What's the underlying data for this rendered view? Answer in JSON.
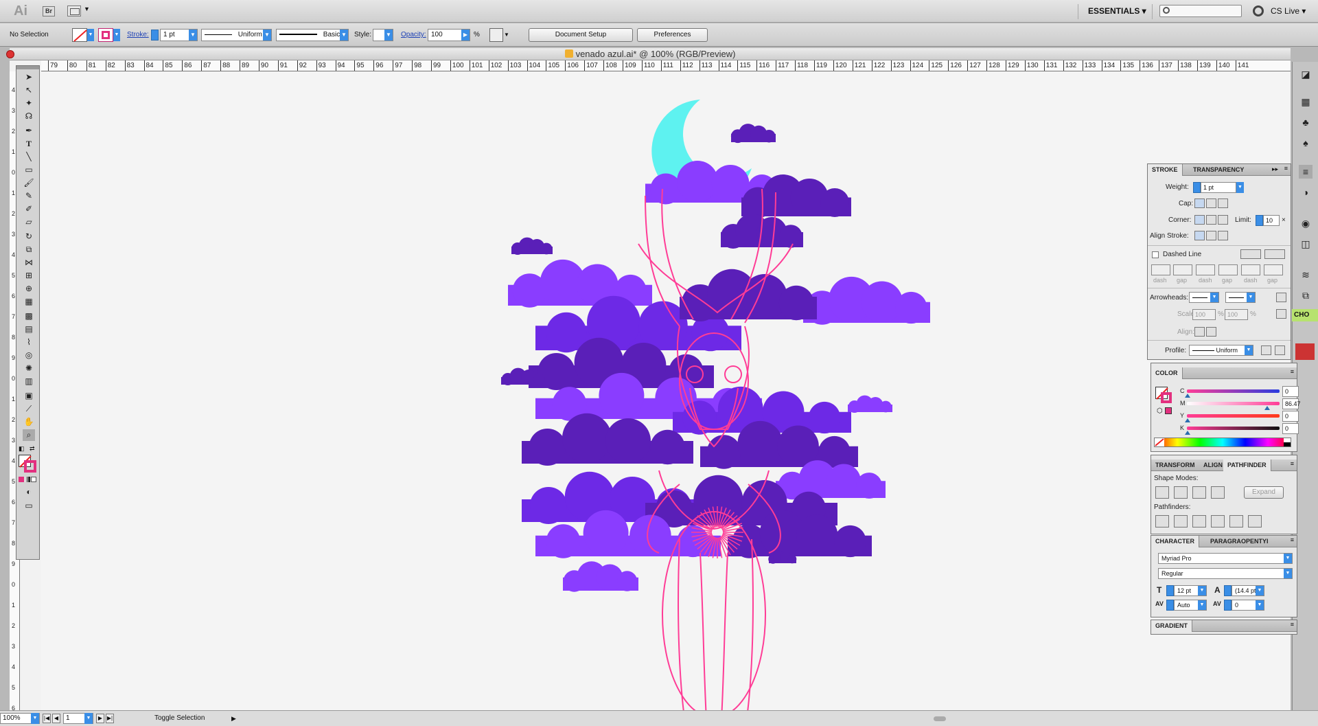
{
  "appbar": {
    "logo": "Ai",
    "bridge": "Br",
    "workspace": "ESSENTIALS ▾",
    "cslive": "CS Live ▾"
  },
  "control": {
    "selection": "No Selection",
    "stroke_label": "Stroke:",
    "stroke_value": "1 pt",
    "profile": "Uniform",
    "brush": "Basic",
    "style_label": "Style:",
    "opacity_label": "Opacity:",
    "opacity_value": "100",
    "percent": "%",
    "doc_setup": "Document Setup",
    "preferences": "Preferences"
  },
  "document": {
    "title": "venado azul.ai* @ 100% (RGB/Preview)",
    "ruler_ticks": [
      "79",
      "80",
      "81",
      "82",
      "83",
      "84",
      "85",
      "86",
      "87",
      "88",
      "89",
      "90",
      "91",
      "92",
      "93",
      "94",
      "95",
      "96",
      "97",
      "98",
      "99",
      "100",
      "101",
      "102",
      "103",
      "104",
      "105",
      "106",
      "107",
      "108",
      "109",
      "110",
      "111",
      "112",
      "113",
      "114",
      "115",
      "116",
      "117",
      "118",
      "119",
      "120",
      "121",
      "122",
      "123",
      "124",
      "125",
      "126",
      "127",
      "128",
      "129",
      "130",
      "131",
      "132",
      "133",
      "134",
      "135",
      "136",
      "137",
      "138",
      "139",
      "140",
      "141"
    ],
    "vruler_ticks": [
      "4",
      "3",
      "2",
      "1",
      "0",
      "1",
      "2",
      "3",
      "4",
      "5",
      "6",
      "7",
      "8",
      "9",
      "0",
      "1",
      "2",
      "3",
      "4",
      "5",
      "6",
      "7",
      "8",
      "9",
      "0",
      "1",
      "2",
      "3",
      "4",
      "5",
      "6",
      "7"
    ]
  },
  "status": {
    "zoom": "100%",
    "page": "1",
    "toggle": "Toggle Selection"
  },
  "stroke_panel": {
    "tabs": [
      "STROKE",
      "TRANSPARENCY"
    ],
    "weight_label": "Weight:",
    "weight_value": "1 pt",
    "cap_label": "Cap:",
    "corner_label": "Corner:",
    "limit_label": "Limit:",
    "limit_value": "10",
    "align_label": "Align Stroke:",
    "dashed": "Dashed Line",
    "dash": "dash",
    "gap": "gap",
    "arrowheads": "Arrowheads:",
    "scale_label": "Scale:",
    "scale_a": "100",
    "scale_b": "100",
    "align2": "Align:",
    "profile_label": "Profile:",
    "profile_value": "Uniform"
  },
  "color_panel": {
    "tab": "COLOR",
    "c_label": "C",
    "c": "0",
    "m_label": "M",
    "m": "86.47",
    "y_label": "Y",
    "y": "0",
    "k_label": "K",
    "k": "0",
    "pct": "%"
  },
  "pathfinder_panel": {
    "tabs": [
      "TRANSFORM",
      "ALIGN",
      "PATHFINDER"
    ],
    "shape_modes": "Shape Modes:",
    "expand": "Expand",
    "pathfinders": "Pathfinders:"
  },
  "character_panel": {
    "tabs": [
      "CHARACTER",
      "PARAGRA",
      "OPENTYI"
    ],
    "font": "Myriad Pro",
    "style": "Regular",
    "size": "12 pt",
    "leading": "(14.4 pt)",
    "kerning": "Auto",
    "tracking": "0"
  },
  "gradient_panel": {
    "tab": "GRADIENT"
  },
  "dock_extra": {
    "green_label": "CHO"
  },
  "art": {
    "moon": "#5ef2f0",
    "cloud_light": "#8a3dff",
    "cloud_mid": "#6d29e6",
    "cloud_dark": "#5a1fb8",
    "deer": "#ff3c96"
  }
}
